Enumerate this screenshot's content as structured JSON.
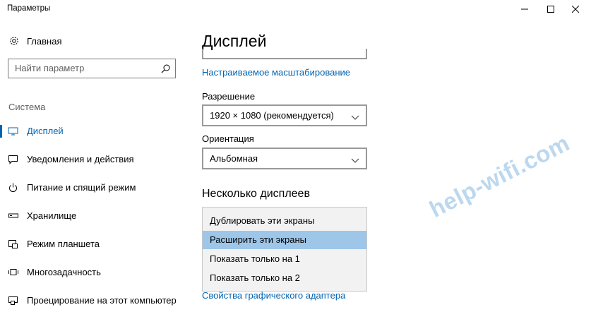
{
  "window": {
    "title": "Параметры"
  },
  "sidebar": {
    "home_label": "Главная",
    "search_placeholder": "Найти параметр",
    "group_label": "Система",
    "items": [
      {
        "label": "Дисплей",
        "icon": "monitor-icon",
        "active": true
      },
      {
        "label": "Уведомления и действия",
        "icon": "notification-icon"
      },
      {
        "label": "Питание и спящий режим",
        "icon": "power-icon"
      },
      {
        "label": "Хранилище",
        "icon": "storage-icon"
      },
      {
        "label": "Режим планшета",
        "icon": "tablet-mode-icon"
      },
      {
        "label": "Многозадачность",
        "icon": "multitasking-icon"
      },
      {
        "label": "Проецирование на этот компьютер",
        "icon": "projecting-icon"
      }
    ]
  },
  "main": {
    "title": "Дисплей",
    "custom_scaling_link": "Настраиваемое масштабирование",
    "resolution": {
      "label": "Разрешение",
      "value": "1920 × 1080 (рекомендуется)"
    },
    "orientation": {
      "label": "Ориентация",
      "value": "Альбомная"
    },
    "multiple_displays": {
      "title": "Несколько дисплеев",
      "options": [
        {
          "label": "Дублировать эти экраны"
        },
        {
          "label": "Расширить эти экраны",
          "selected": true
        },
        {
          "label": "Показать только на 1"
        },
        {
          "label": "Показать только на 2"
        }
      ]
    },
    "adapter_link": "Свойства графического адаптера"
  },
  "watermark": "help-wifi.com",
  "colors": {
    "accent": "#0063b1",
    "selected_bg": "#9dc6e9",
    "menu_bg": "#f2f2f2"
  }
}
